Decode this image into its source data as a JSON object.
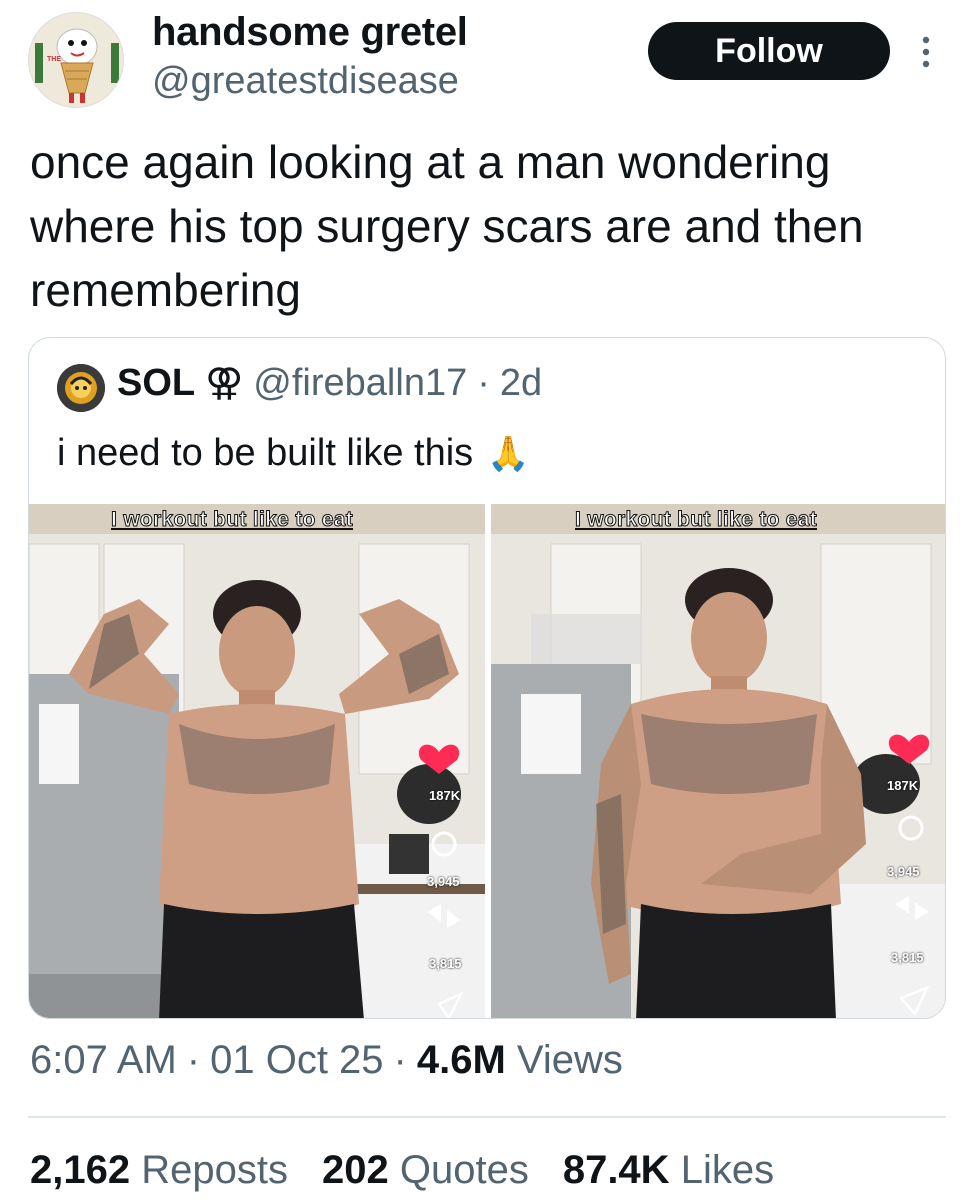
{
  "author": {
    "display_name": "handsome gretel",
    "handle": "@greatestdisease",
    "avatar_icon": "cartoon-mascot-avatar",
    "avatar_text": "THE"
  },
  "follow_label": "Follow",
  "more_icon": "vertical-ellipsis-icon",
  "tweet_text": "once again looking at a man wondering where his top surgery scars are and then remembering",
  "quoted": {
    "display_name": "SOL",
    "symbol": "⚢",
    "handle": "@fireballn17",
    "separator": "·",
    "time": "2d",
    "text": "i need to be built like this",
    "emoji": "🙏",
    "avatar_icon": "fireball-avatar",
    "media": [
      {
        "caption": "I workout but like to eat",
        "likes": "187K",
        "comments": "3,945",
        "reposts": "3,815"
      },
      {
        "caption": "I workout but like to eat",
        "likes": "187K",
        "comments": "3,945",
        "reposts": "3,815"
      }
    ]
  },
  "meta": {
    "time": "6:07 AM",
    "sep1": "·",
    "date": "01 Oct 25",
    "sep2": "·",
    "views_count": "4.6M",
    "views_label": "Views"
  },
  "stats": {
    "reposts_count": "2,162",
    "reposts_label": "Reposts",
    "quotes_count": "202",
    "quotes_label": "Quotes",
    "likes_count": "87.4K",
    "likes_label": "Likes"
  },
  "colors": {
    "text_primary": "#0f1419",
    "text_secondary": "#536471",
    "border": "#cfd9de",
    "heart": "#fe2c55"
  }
}
